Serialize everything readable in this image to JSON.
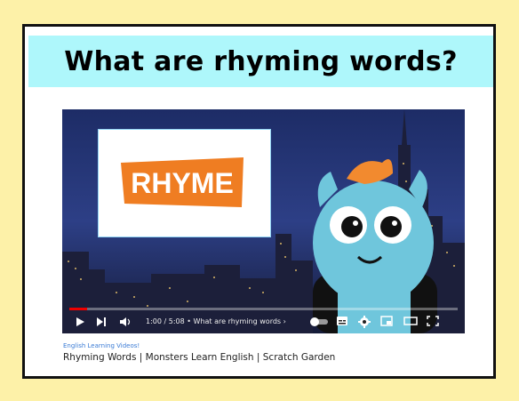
{
  "page": {
    "title": "What are rhyming words?"
  },
  "video": {
    "thumbnail_text": "RHYME",
    "current_time": "1:00",
    "duration": "5:08",
    "chapter": "What are rhyming words",
    "progress": 0.045,
    "controls": [
      "play-icon",
      "next-icon",
      "volume-icon",
      "autoplay-toggle",
      "captions-icon",
      "settings-icon",
      "miniplayer-icon",
      "theater-icon",
      "fullscreen-icon"
    ]
  },
  "caption": {
    "channel": "English Learning Videos!",
    "title": "Rhyming Words | Monsters Learn English | Scratch Garden"
  },
  "colors": {
    "background": "#fdf1a8",
    "banner": "#aef7fb",
    "rhyme_orange": "#ef7d22",
    "monster": "#6fc6dc",
    "monster_hair": "#f28a2f"
  }
}
